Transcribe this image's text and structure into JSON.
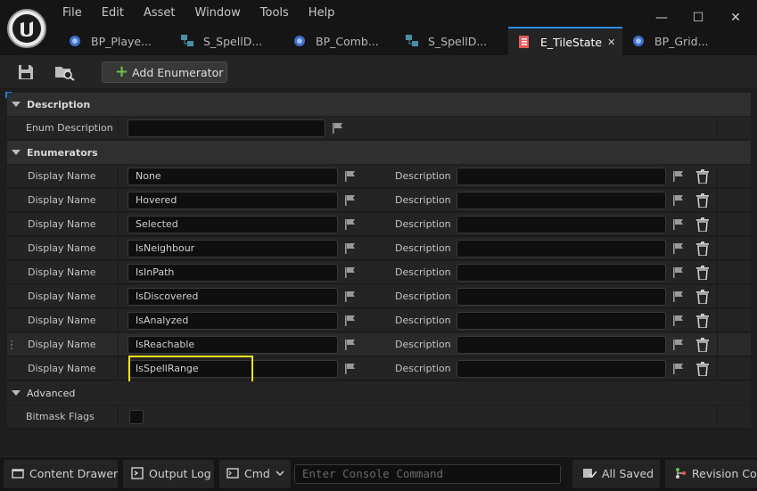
{
  "menu": [
    "File",
    "Edit",
    "Asset",
    "Window",
    "Tools",
    "Help"
  ],
  "window_controls": {
    "minimize": "—",
    "maximize": "☐",
    "close": "✕"
  },
  "tabs": [
    {
      "label": "BP_Playe...",
      "icon": "blueprint-icon"
    },
    {
      "label": "S_SpellD...",
      "icon": "struct-icon"
    },
    {
      "label": "BP_Comb...",
      "icon": "blueprint-icon"
    },
    {
      "label": "S_SpellD...",
      "icon": "struct-icon"
    },
    {
      "label": "E_TileState",
      "icon": "enum-icon",
      "active": true,
      "close": "✕"
    },
    {
      "label": "BP_Grid...",
      "icon": "blueprint-icon"
    }
  ],
  "toolbar": {
    "add_label": "Add Enumerator",
    "plus": "+"
  },
  "sections": {
    "description": "Description",
    "enumerators": "Enumerators",
    "advanced": "Advanced"
  },
  "enum_description": {
    "label": "Enum Description",
    "value": ""
  },
  "enumerators": [
    {
      "label": "Display Name",
      "value": "None",
      "desc_label": "Description",
      "desc": ""
    },
    {
      "label": "Display Name",
      "value": "Hovered",
      "desc_label": "Description",
      "desc": ""
    },
    {
      "label": "Display Name",
      "value": "Selected",
      "desc_label": "Description",
      "desc": ""
    },
    {
      "label": "Display Name",
      "value": "IsNeighbour",
      "desc_label": "Description",
      "desc": ""
    },
    {
      "label": "Display Name",
      "value": "IsInPath",
      "desc_label": "Description",
      "desc": ""
    },
    {
      "label": "Display Name",
      "value": "IsDiscovered",
      "desc_label": "Description",
      "desc": ""
    },
    {
      "label": "Display Name",
      "value": "IsAnalyzed",
      "desc_label": "Description",
      "desc": ""
    },
    {
      "label": "Display Name",
      "value": "IsReachable",
      "desc_label": "Description",
      "desc": ""
    },
    {
      "label": "Display Name",
      "value": "IsSpellRange",
      "desc_label": "Description",
      "desc": ""
    }
  ],
  "bitmask": {
    "label": "Bitmask Flags",
    "checked": false
  },
  "status": {
    "content_drawer": "Content Drawer",
    "output_log": "Output Log",
    "cmd": "Cmd",
    "cmd_placeholder": "Enter Console Command",
    "saved": "All Saved",
    "revision": "Revision Con"
  },
  "colors": {
    "accent": "#2a8fe8",
    "highlight": "#f2e41a",
    "add_green": "#6cc04a"
  }
}
